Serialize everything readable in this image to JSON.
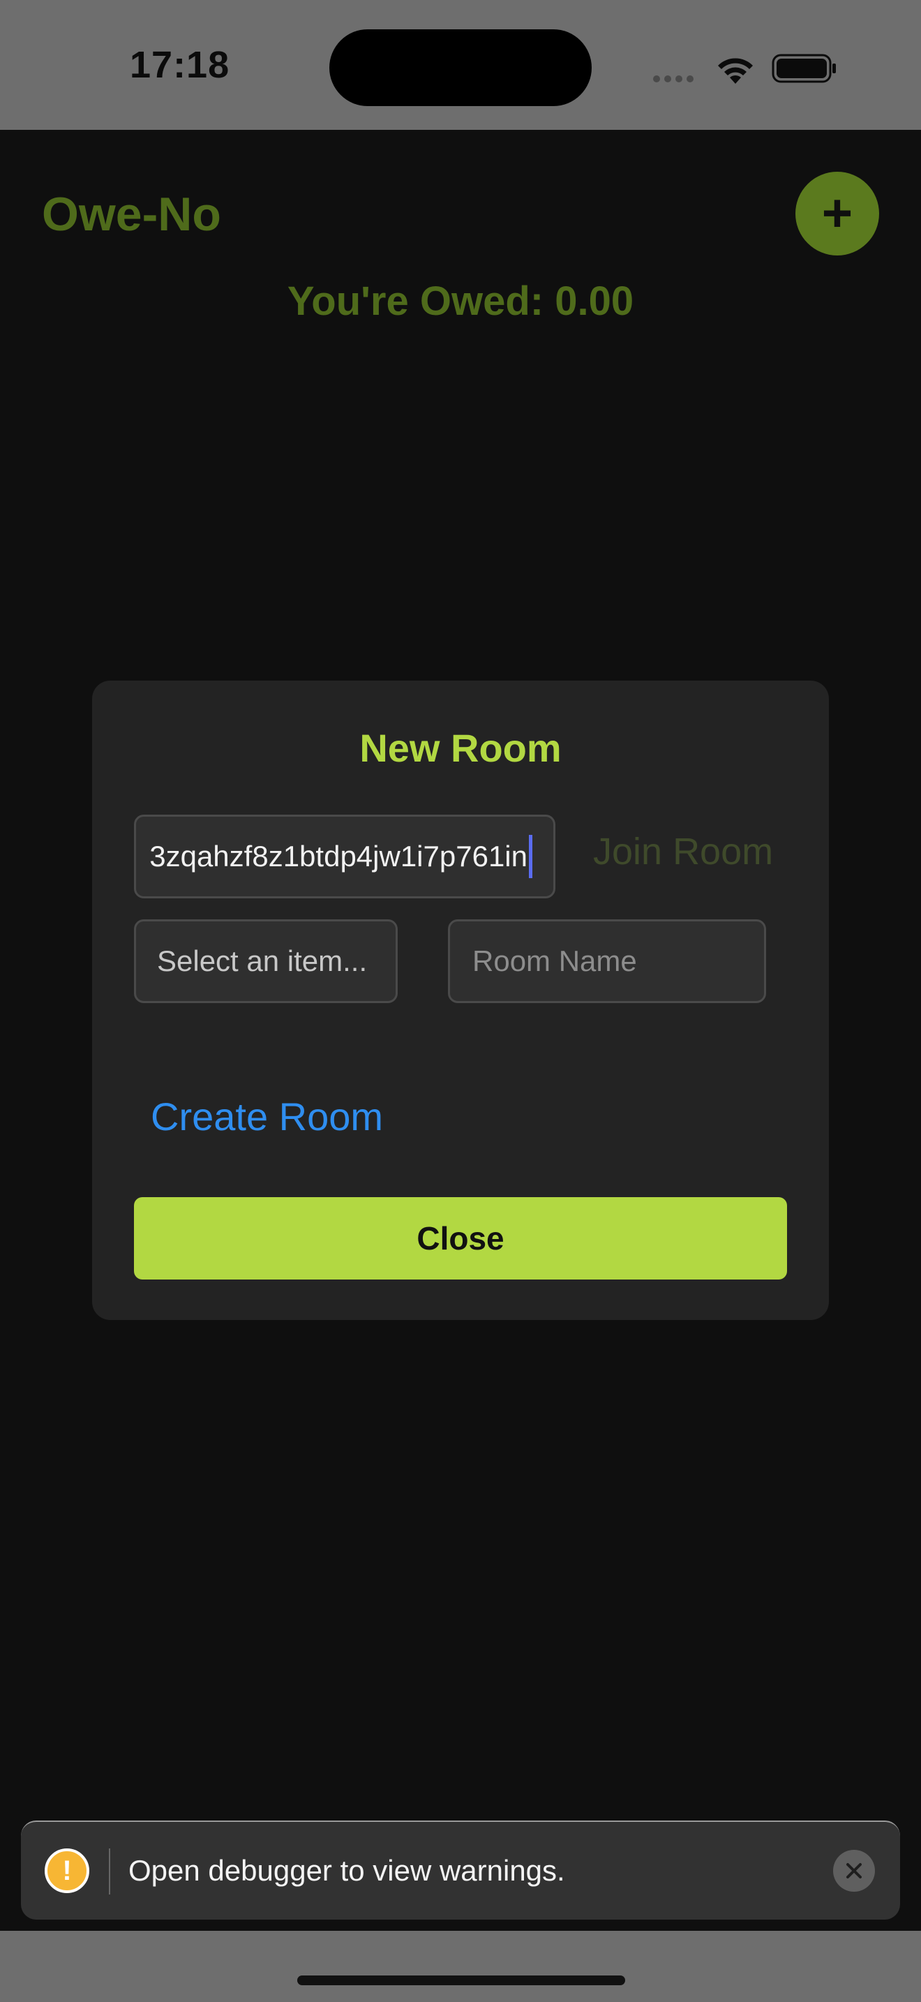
{
  "status_bar": {
    "time": "17:18",
    "icons": [
      "signal-dots-icon",
      "wifi-icon",
      "battery-icon"
    ]
  },
  "app": {
    "title": "Owe-No",
    "add_button_label": "+",
    "owed_text": "You're Owed: 0.00",
    "accent_color": "#b2d842"
  },
  "modal": {
    "title": "New Room",
    "room_code_value": "3zqahzf8z1btdp4jw1i7p761in",
    "join_label": "Join Room",
    "select_placeholder": "Select an item...",
    "room_name_placeholder": "Room Name",
    "create_label": "Create Room",
    "close_label": "Close"
  },
  "toast": {
    "icon": "warning-icon",
    "message": "Open debugger to view warnings.",
    "close_icon": "close-icon"
  }
}
